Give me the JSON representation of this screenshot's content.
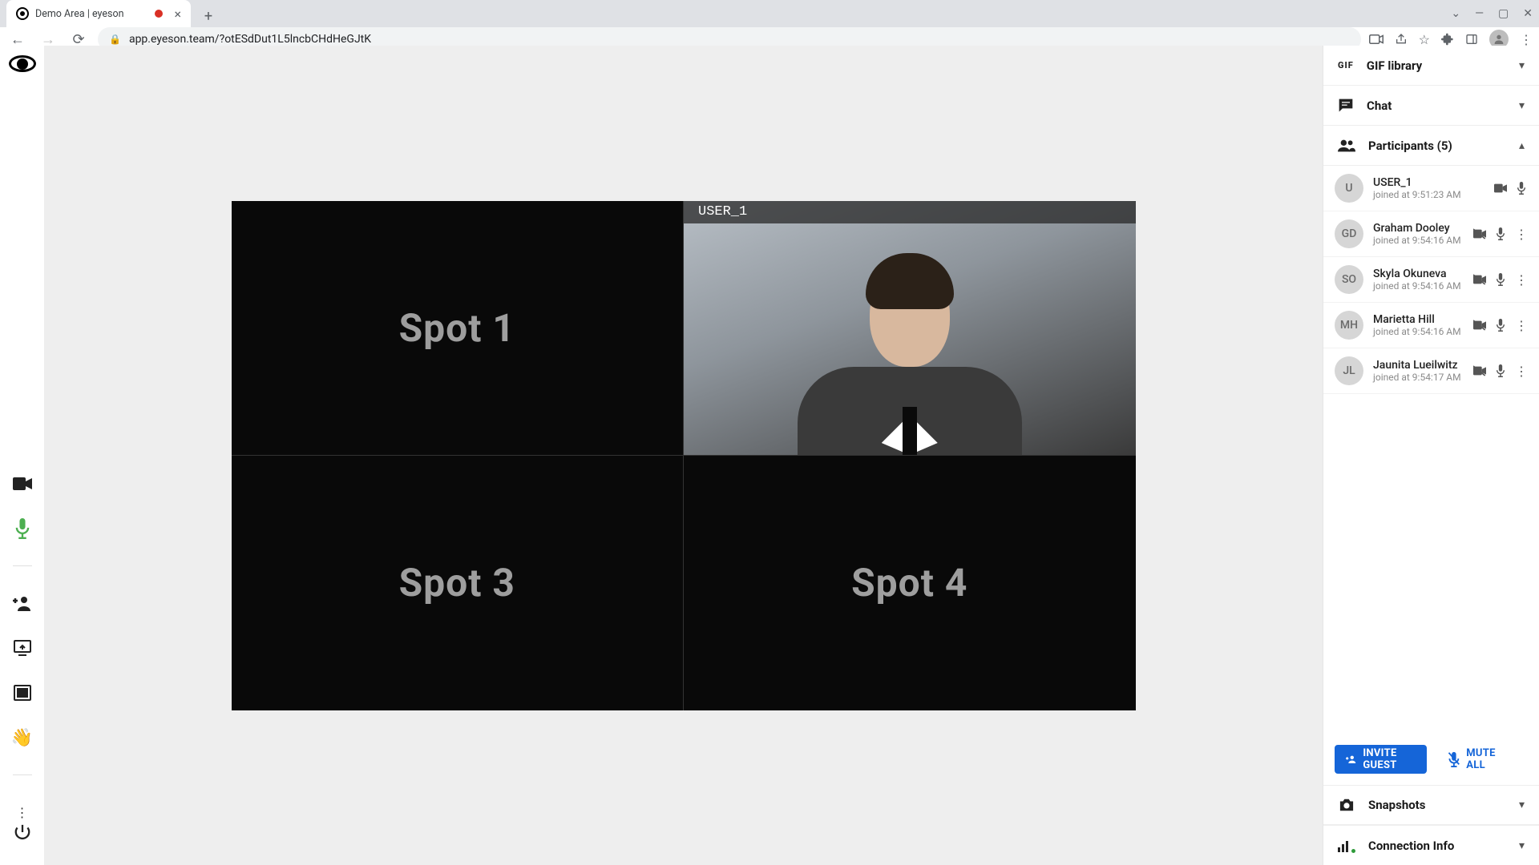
{
  "browser": {
    "tab_title": "Demo Area | eyeson",
    "url": "app.eyeson.team/?otESdDut1L5lncbCHdHeGJtK"
  },
  "stage": {
    "spots": [
      "Spot 1",
      "",
      "Spot 3",
      "Spot 4"
    ],
    "active_user_label": "USER_1"
  },
  "sidebar": {
    "gif_label": "GIF library",
    "chat_label": "Chat",
    "participants_label": "Participants (5)",
    "snapshots_label": "Snapshots",
    "connection_label": "Connection Info",
    "invite_label": "INVITE GUEST",
    "mute_all_label": "MUTE ALL",
    "participants": [
      {
        "initials": "U",
        "name": "USER_1",
        "joined": "joined at 9:51:23 AM",
        "cam_on": true,
        "has_more": false
      },
      {
        "initials": "GD",
        "name": "Graham Dooley",
        "joined": "joined at 9:54:16 AM",
        "cam_on": false,
        "has_more": true
      },
      {
        "initials": "SO",
        "name": "Skyla Okuneva",
        "joined": "joined at 9:54:16 AM",
        "cam_on": false,
        "has_more": true
      },
      {
        "initials": "MH",
        "name": "Marietta Hill",
        "joined": "joined at 9:54:16 AM",
        "cam_on": false,
        "has_more": true
      },
      {
        "initials": "JL",
        "name": "Jaunita Lueilwitz",
        "joined": "joined at 9:54:17 AM",
        "cam_on": false,
        "has_more": true
      }
    ]
  }
}
